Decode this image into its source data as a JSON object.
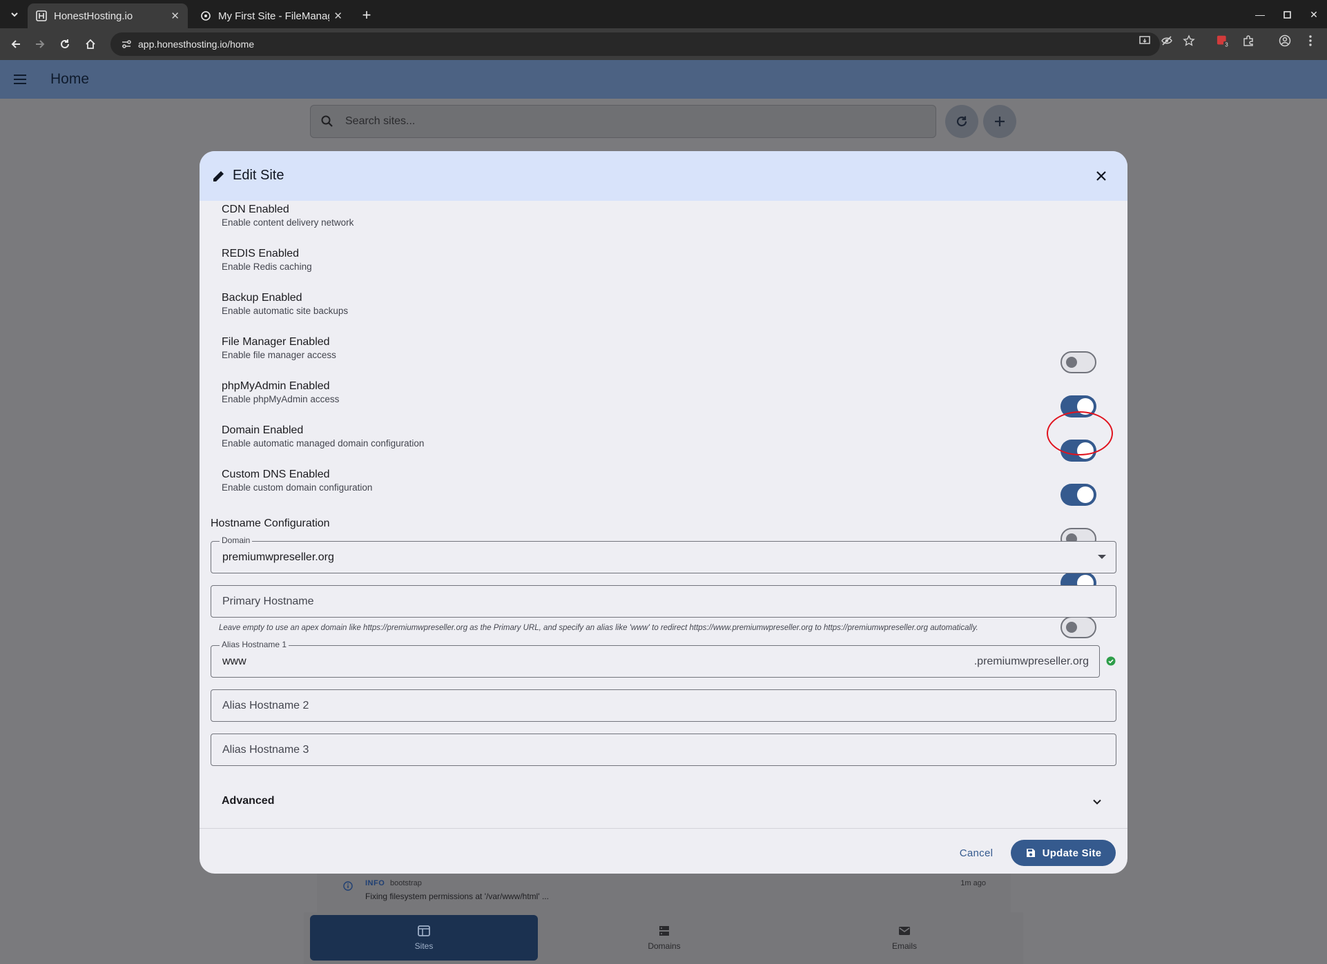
{
  "browser": {
    "tabs": [
      {
        "title": "HonestHosting.io",
        "active": true
      },
      {
        "title": "My First Site - FileManag",
        "active": false
      }
    ],
    "url": "app.honesthosting.io/home",
    "extension_badge": "3"
  },
  "app": {
    "title": "Home",
    "search": {
      "placeholder": "Search sites..."
    }
  },
  "dialog": {
    "title": "Edit Site",
    "toggles": [
      {
        "label": "CDN Enabled",
        "description": "Enable content delivery network",
        "on": false
      },
      {
        "label": "REDIS Enabled",
        "description": "Enable Redis caching",
        "on": true
      },
      {
        "label": "Backup Enabled",
        "description": "Enable automatic site backups",
        "on": true
      },
      {
        "label": "File Manager Enabled",
        "description": "Enable file manager access",
        "on": true
      },
      {
        "label": "phpMyAdmin Enabled",
        "description": "Enable phpMyAdmin access",
        "on": false
      },
      {
        "label": "Domain Enabled",
        "description": "Enable automatic managed domain configuration",
        "on": true
      },
      {
        "label": "Custom DNS Enabled",
        "description": "Enable custom domain configuration",
        "on": false
      }
    ],
    "hostname_section": "Hostname Configuration",
    "domain": {
      "label": "Domain",
      "value": "premiumwpreseller.org"
    },
    "primary_hostname": {
      "placeholder": "Primary Hostname"
    },
    "hint": "Leave empty to use an apex domain like https://premiumwpreseller.org as the Primary URL, and specify an alias like 'www' to redirect https://www.premiumwpreseller.org to https://premiumwpreseller.org automatically.",
    "alias1": {
      "label": "Alias Hostname 1",
      "value": "www",
      "suffix": ".premiumwpreseller.org"
    },
    "alias2": {
      "placeholder": "Alias Hostname 2"
    },
    "alias3": {
      "placeholder": "Alias Hostname 3"
    },
    "advanced": "Advanced",
    "cancel": "Cancel",
    "update": "Update Site"
  },
  "log": {
    "level": "INFO",
    "source": "bootstrap",
    "time": "1m ago",
    "message": "Fixing filesystem permissions at '/var/www/html' ..."
  },
  "nav": [
    {
      "label": "Sites",
      "icon": "sites-icon",
      "active": true
    },
    {
      "label": "Domains",
      "icon": "domains-icon",
      "active": false
    },
    {
      "label": "Emails",
      "icon": "emails-icon",
      "active": false
    }
  ],
  "colors": {
    "primary": "#355a8e",
    "appbar": "#4c6283",
    "dialog_header": "#d8e3fa",
    "annotation": "#e0141f",
    "valid": "#2e9e4a"
  }
}
